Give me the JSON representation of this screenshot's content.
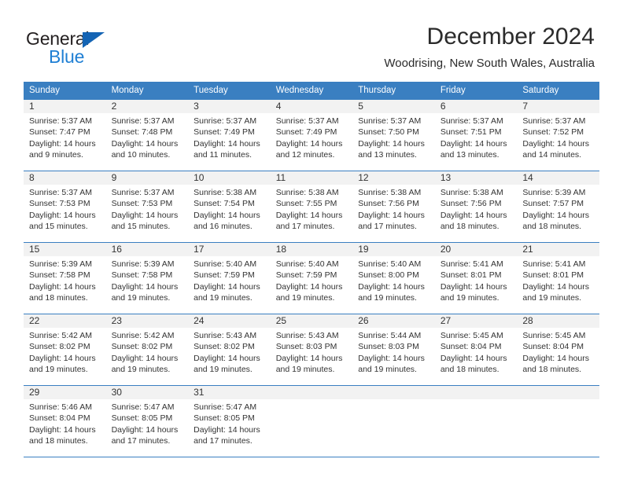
{
  "brand": {
    "name_top": "General",
    "name_bottom": "Blue",
    "triangle_color": "#1464b4",
    "bottom_color": "#1f7fd4"
  },
  "header": {
    "title": "December 2024",
    "subtitle": "Woodrising, New South Wales, Australia"
  },
  "theme": {
    "header_bg": "#3a7fc1",
    "header_text": "#ffffff",
    "daynum_strip_bg": "#f2f2f2",
    "grid_line": "#3a7fc1",
    "body_text": "#333333"
  },
  "columns": [
    "Sunday",
    "Monday",
    "Tuesday",
    "Wednesday",
    "Thursday",
    "Friday",
    "Saturday"
  ],
  "weeks": [
    [
      {
        "day": "1",
        "sunrise": "Sunrise: 5:37 AM",
        "sunset": "Sunset: 7:47 PM",
        "daylight1": "Daylight: 14 hours",
        "daylight2": "and 9 minutes."
      },
      {
        "day": "2",
        "sunrise": "Sunrise: 5:37 AM",
        "sunset": "Sunset: 7:48 PM",
        "daylight1": "Daylight: 14 hours",
        "daylight2": "and 10 minutes."
      },
      {
        "day": "3",
        "sunrise": "Sunrise: 5:37 AM",
        "sunset": "Sunset: 7:49 PM",
        "daylight1": "Daylight: 14 hours",
        "daylight2": "and 11 minutes."
      },
      {
        "day": "4",
        "sunrise": "Sunrise: 5:37 AM",
        "sunset": "Sunset: 7:49 PM",
        "daylight1": "Daylight: 14 hours",
        "daylight2": "and 12 minutes."
      },
      {
        "day": "5",
        "sunrise": "Sunrise: 5:37 AM",
        "sunset": "Sunset: 7:50 PM",
        "daylight1": "Daylight: 14 hours",
        "daylight2": "and 13 minutes."
      },
      {
        "day": "6",
        "sunrise": "Sunrise: 5:37 AM",
        "sunset": "Sunset: 7:51 PM",
        "daylight1": "Daylight: 14 hours",
        "daylight2": "and 13 minutes."
      },
      {
        "day": "7",
        "sunrise": "Sunrise: 5:37 AM",
        "sunset": "Sunset: 7:52 PM",
        "daylight1": "Daylight: 14 hours",
        "daylight2": "and 14 minutes."
      }
    ],
    [
      {
        "day": "8",
        "sunrise": "Sunrise: 5:37 AM",
        "sunset": "Sunset: 7:53 PM",
        "daylight1": "Daylight: 14 hours",
        "daylight2": "and 15 minutes."
      },
      {
        "day": "9",
        "sunrise": "Sunrise: 5:37 AM",
        "sunset": "Sunset: 7:53 PM",
        "daylight1": "Daylight: 14 hours",
        "daylight2": "and 15 minutes."
      },
      {
        "day": "10",
        "sunrise": "Sunrise: 5:38 AM",
        "sunset": "Sunset: 7:54 PM",
        "daylight1": "Daylight: 14 hours",
        "daylight2": "and 16 minutes."
      },
      {
        "day": "11",
        "sunrise": "Sunrise: 5:38 AM",
        "sunset": "Sunset: 7:55 PM",
        "daylight1": "Daylight: 14 hours",
        "daylight2": "and 17 minutes."
      },
      {
        "day": "12",
        "sunrise": "Sunrise: 5:38 AM",
        "sunset": "Sunset: 7:56 PM",
        "daylight1": "Daylight: 14 hours",
        "daylight2": "and 17 minutes."
      },
      {
        "day": "13",
        "sunrise": "Sunrise: 5:38 AM",
        "sunset": "Sunset: 7:56 PM",
        "daylight1": "Daylight: 14 hours",
        "daylight2": "and 18 minutes."
      },
      {
        "day": "14",
        "sunrise": "Sunrise: 5:39 AM",
        "sunset": "Sunset: 7:57 PM",
        "daylight1": "Daylight: 14 hours",
        "daylight2": "and 18 minutes."
      }
    ],
    [
      {
        "day": "15",
        "sunrise": "Sunrise: 5:39 AM",
        "sunset": "Sunset: 7:58 PM",
        "daylight1": "Daylight: 14 hours",
        "daylight2": "and 18 minutes."
      },
      {
        "day": "16",
        "sunrise": "Sunrise: 5:39 AM",
        "sunset": "Sunset: 7:58 PM",
        "daylight1": "Daylight: 14 hours",
        "daylight2": "and 19 minutes."
      },
      {
        "day": "17",
        "sunrise": "Sunrise: 5:40 AM",
        "sunset": "Sunset: 7:59 PM",
        "daylight1": "Daylight: 14 hours",
        "daylight2": "and 19 minutes."
      },
      {
        "day": "18",
        "sunrise": "Sunrise: 5:40 AM",
        "sunset": "Sunset: 7:59 PM",
        "daylight1": "Daylight: 14 hours",
        "daylight2": "and 19 minutes."
      },
      {
        "day": "19",
        "sunrise": "Sunrise: 5:40 AM",
        "sunset": "Sunset: 8:00 PM",
        "daylight1": "Daylight: 14 hours",
        "daylight2": "and 19 minutes."
      },
      {
        "day": "20",
        "sunrise": "Sunrise: 5:41 AM",
        "sunset": "Sunset: 8:01 PM",
        "daylight1": "Daylight: 14 hours",
        "daylight2": "and 19 minutes."
      },
      {
        "day": "21",
        "sunrise": "Sunrise: 5:41 AM",
        "sunset": "Sunset: 8:01 PM",
        "daylight1": "Daylight: 14 hours",
        "daylight2": "and 19 minutes."
      }
    ],
    [
      {
        "day": "22",
        "sunrise": "Sunrise: 5:42 AM",
        "sunset": "Sunset: 8:02 PM",
        "daylight1": "Daylight: 14 hours",
        "daylight2": "and 19 minutes."
      },
      {
        "day": "23",
        "sunrise": "Sunrise: 5:42 AM",
        "sunset": "Sunset: 8:02 PM",
        "daylight1": "Daylight: 14 hours",
        "daylight2": "and 19 minutes."
      },
      {
        "day": "24",
        "sunrise": "Sunrise: 5:43 AM",
        "sunset": "Sunset: 8:02 PM",
        "daylight1": "Daylight: 14 hours",
        "daylight2": "and 19 minutes."
      },
      {
        "day": "25",
        "sunrise": "Sunrise: 5:43 AM",
        "sunset": "Sunset: 8:03 PM",
        "daylight1": "Daylight: 14 hours",
        "daylight2": "and 19 minutes."
      },
      {
        "day": "26",
        "sunrise": "Sunrise: 5:44 AM",
        "sunset": "Sunset: 8:03 PM",
        "daylight1": "Daylight: 14 hours",
        "daylight2": "and 19 minutes."
      },
      {
        "day": "27",
        "sunrise": "Sunrise: 5:45 AM",
        "sunset": "Sunset: 8:04 PM",
        "daylight1": "Daylight: 14 hours",
        "daylight2": "and 18 minutes."
      },
      {
        "day": "28",
        "sunrise": "Sunrise: 5:45 AM",
        "sunset": "Sunset: 8:04 PM",
        "daylight1": "Daylight: 14 hours",
        "daylight2": "and 18 minutes."
      }
    ],
    [
      {
        "day": "29",
        "sunrise": "Sunrise: 5:46 AM",
        "sunset": "Sunset: 8:04 PM",
        "daylight1": "Daylight: 14 hours",
        "daylight2": "and 18 minutes."
      },
      {
        "day": "30",
        "sunrise": "Sunrise: 5:47 AM",
        "sunset": "Sunset: 8:05 PM",
        "daylight1": "Daylight: 14 hours",
        "daylight2": "and 17 minutes."
      },
      {
        "day": "31",
        "sunrise": "Sunrise: 5:47 AM",
        "sunset": "Sunset: 8:05 PM",
        "daylight1": "Daylight: 14 hours",
        "daylight2": "and 17 minutes."
      },
      {
        "day": "",
        "sunrise": "",
        "sunset": "",
        "daylight1": "",
        "daylight2": ""
      },
      {
        "day": "",
        "sunrise": "",
        "sunset": "",
        "daylight1": "",
        "daylight2": ""
      },
      {
        "day": "",
        "sunrise": "",
        "sunset": "",
        "daylight1": "",
        "daylight2": ""
      },
      {
        "day": "",
        "sunrise": "",
        "sunset": "",
        "daylight1": "",
        "daylight2": ""
      }
    ]
  ]
}
